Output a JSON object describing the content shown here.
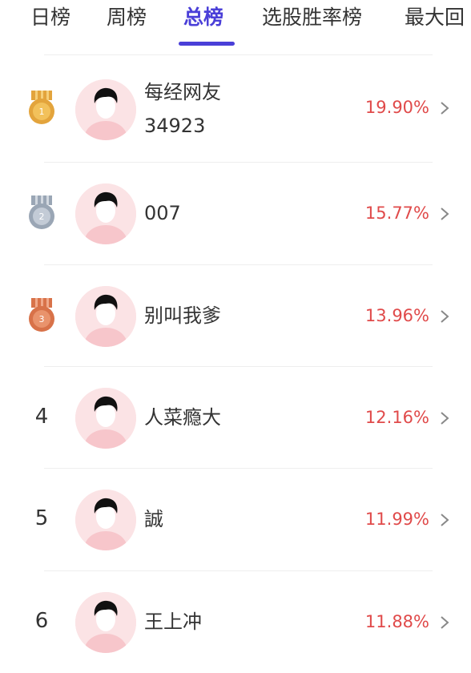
{
  "tabs": [
    {
      "label": "日榜",
      "active": false
    },
    {
      "label": "周榜",
      "active": false
    },
    {
      "label": "总榜",
      "active": true
    },
    {
      "label": "选股胜率榜",
      "active": false
    },
    {
      "label": "最大回",
      "active": false
    }
  ],
  "colors": {
    "accent": "#4a3fd8",
    "rate": "#e04a4a",
    "text": "#333333",
    "gold_medal": "#e3a43c",
    "silver_medal": "#9aa6b5",
    "bronze_medal": "#d87249",
    "avatar_bg": "#fbe3e5"
  },
  "ranking": [
    {
      "rank": "1",
      "badge": "gold-medal-icon",
      "name_line1": "每经网友",
      "name_line2": "34923",
      "rate": "19.90%"
    },
    {
      "rank": "2",
      "badge": "silver-medal-icon",
      "name_line1": "007",
      "name_line2": "",
      "rate": "15.77%"
    },
    {
      "rank": "3",
      "badge": "bronze-medal-icon",
      "name_line1": "别叫我爹",
      "name_line2": "",
      "rate": "13.96%"
    },
    {
      "rank": "4",
      "badge": "",
      "name_line1": "人菜瘾大",
      "name_line2": "",
      "rate": "12.16%"
    },
    {
      "rank": "5",
      "badge": "",
      "name_line1": "誠",
      "name_line2": "",
      "rate": "11.99%"
    },
    {
      "rank": "6",
      "badge": "",
      "name_line1": "王上冲",
      "name_line2": "",
      "rate": "11.88%"
    }
  ]
}
